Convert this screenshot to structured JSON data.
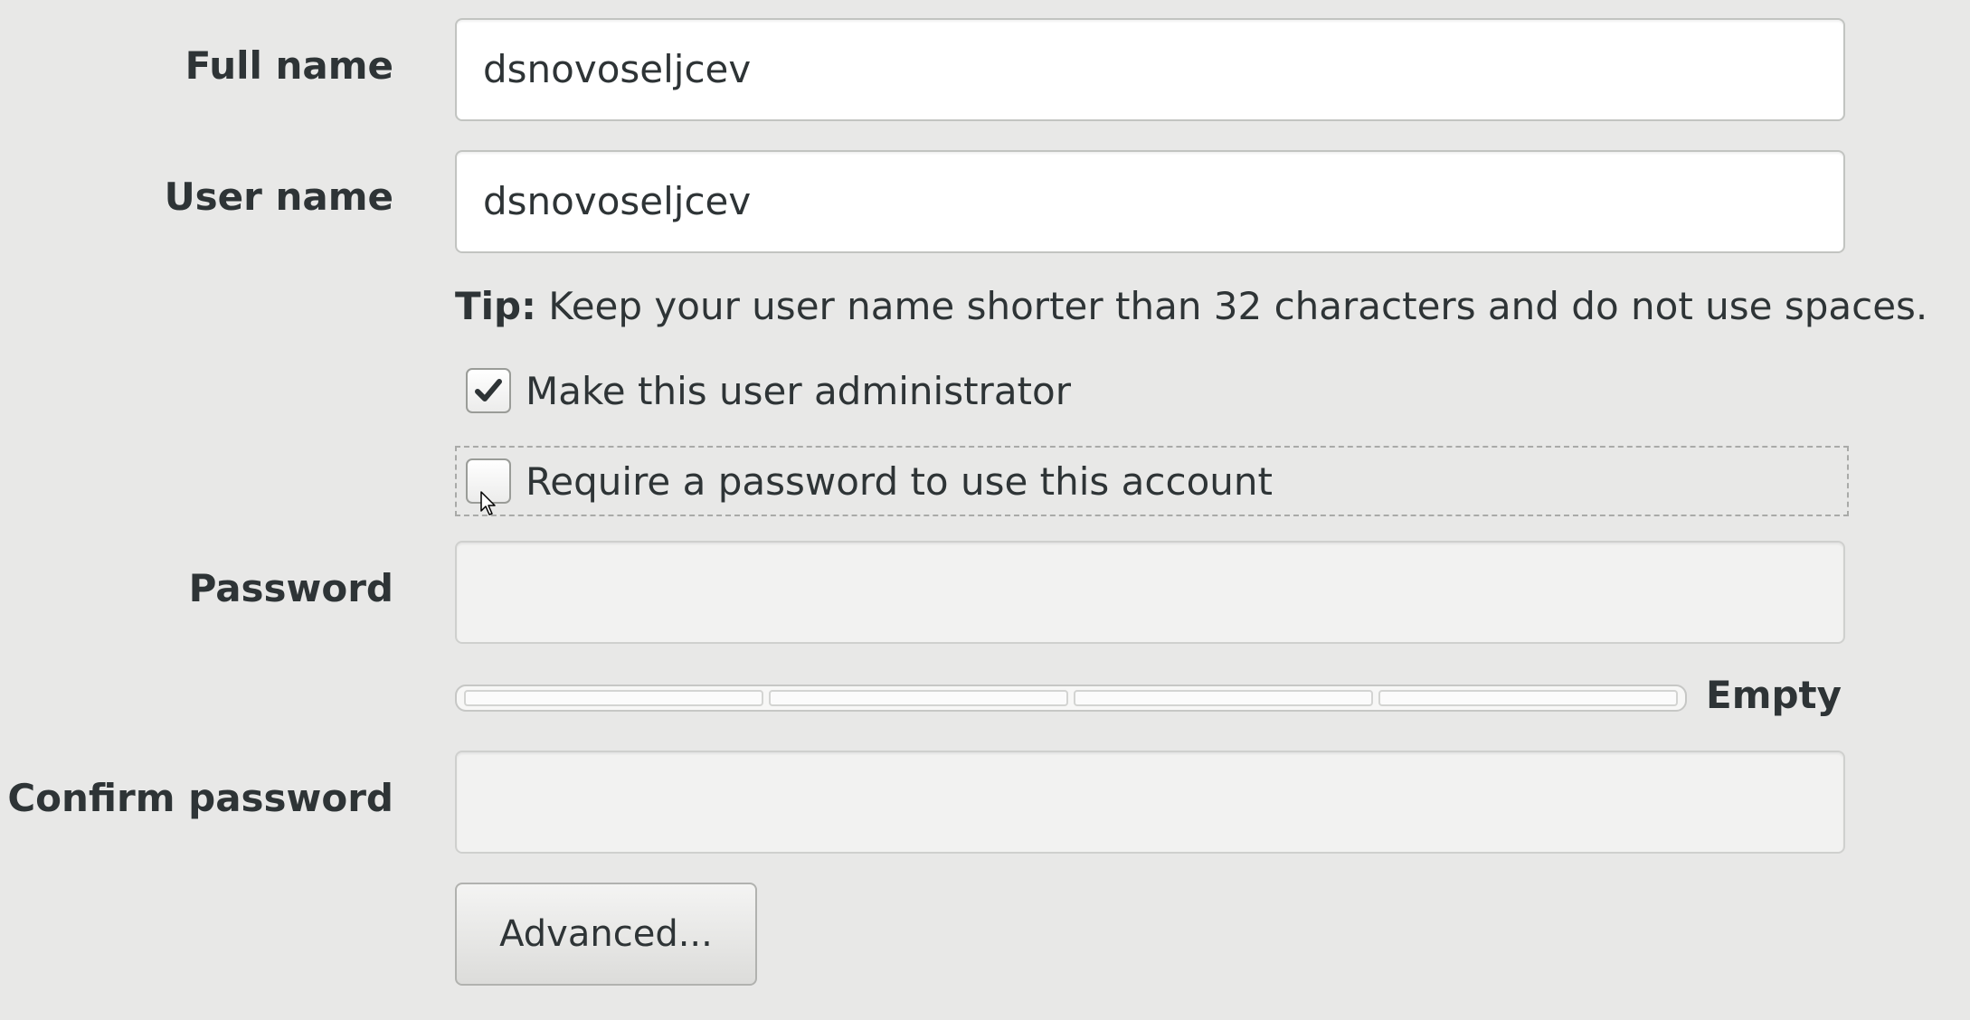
{
  "form": {
    "full_name": {
      "label": "Full name",
      "value": "dsnovoseljcev"
    },
    "user_name": {
      "label": "User name",
      "value": "dsnovoseljcev"
    },
    "tip": {
      "prefix": "Tip:",
      "text": " Keep your user name shorter than 32 characters and do not use spaces."
    },
    "admin_checkbox": {
      "label": "Make this user administrator",
      "checked": true
    },
    "password_checkbox": {
      "label": "Require a password to use this account",
      "checked": false
    },
    "password": {
      "label": "Password",
      "value": ""
    },
    "strength": {
      "label": "Empty",
      "level": 0
    },
    "confirm_password": {
      "label": "Confirm password",
      "value": ""
    },
    "advanced_button": {
      "label": "Advanced..."
    }
  },
  "colors": {
    "background": "#e8e8e7",
    "text": "#2e3436",
    "entry_border": "#c2c4c1"
  },
  "icons": {
    "check": "check-icon",
    "cursor": "mouse-pointer-icon"
  }
}
